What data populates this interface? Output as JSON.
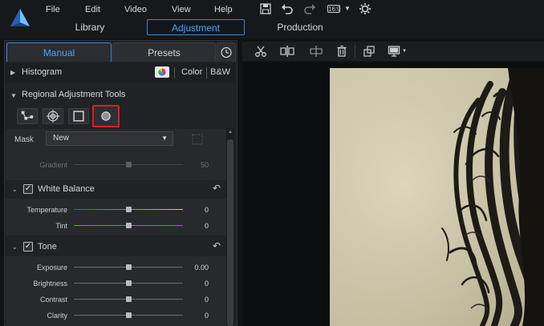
{
  "app": {
    "menu": [
      "File",
      "Edit",
      "Video",
      "View",
      "Help"
    ],
    "aspect_ratio": "16:9",
    "modes": [
      "Library",
      "Adjustment",
      "Production"
    ],
    "active_mode": "Adjustment"
  },
  "panel": {
    "tabs": {
      "manual": "Manual",
      "presets": "Presets"
    },
    "histogram": {
      "title": "Histogram",
      "color": "Color",
      "bw": "B&W"
    },
    "regional": {
      "title": "Regional Adjustment Tools",
      "mask_label": "Mask",
      "mask_value": "New",
      "gradient_label": "Gradient",
      "gradient_value": "50"
    },
    "white_balance": {
      "title": "White Balance",
      "temperature_label": "Temperature",
      "temperature_value": "0",
      "tint_label": "Tint",
      "tint_value": "0"
    },
    "tone": {
      "title": "Tone",
      "exposure_label": "Exposure",
      "exposure_value": "0.00",
      "brightness_label": "Brightness",
      "brightness_value": "0",
      "contrast_label": "Contrast",
      "contrast_value": "0",
      "clarity_label": "Clarity",
      "clarity_value": "0"
    }
  },
  "colors": {
    "accent": "#3a89d6",
    "highlight": "#e11b22",
    "photo_tone": "#d4ceb2"
  }
}
